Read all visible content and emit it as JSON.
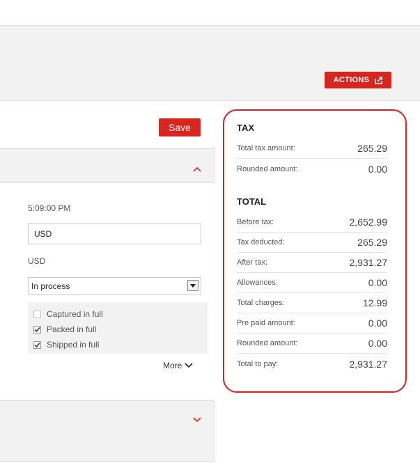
{
  "header": {
    "actions_label": "ACTIONS"
  },
  "form": {
    "save_label": "Save",
    "time": "5:09:00 PM",
    "currency_value": "USD",
    "currency_text": "USD",
    "status_value": "In process",
    "checks": [
      {
        "label": "Captured in full",
        "checked": false
      },
      {
        "label": "Packed in full",
        "checked": true
      },
      {
        "label": "Shipped in full",
        "checked": true
      }
    ],
    "more_label": "More"
  },
  "tax": {
    "title": "TAX",
    "rows": [
      {
        "label": "Total tax amount:",
        "value": "265.29"
      },
      {
        "label": "Rounded amount:",
        "value": "0.00"
      }
    ]
  },
  "total": {
    "title": "TOTAL",
    "rows": [
      {
        "label": "Before tax:",
        "value": "2,652.99"
      },
      {
        "label": "Tax deducted:",
        "value": "265.29"
      },
      {
        "label": "After tax:",
        "value": "2,931.27"
      },
      {
        "label": "Allowances:",
        "value": "0.00"
      },
      {
        "label": "Total charges:",
        "value": "12.99"
      },
      {
        "label": "Pre paid amount:",
        "value": "0.00"
      },
      {
        "label": "Rounded amount:",
        "value": "0.00"
      },
      {
        "label": "Total to pay:",
        "value": "2,931.27"
      }
    ]
  },
  "colors": {
    "accent": "#d9261c",
    "highlight": "#e01b24"
  }
}
